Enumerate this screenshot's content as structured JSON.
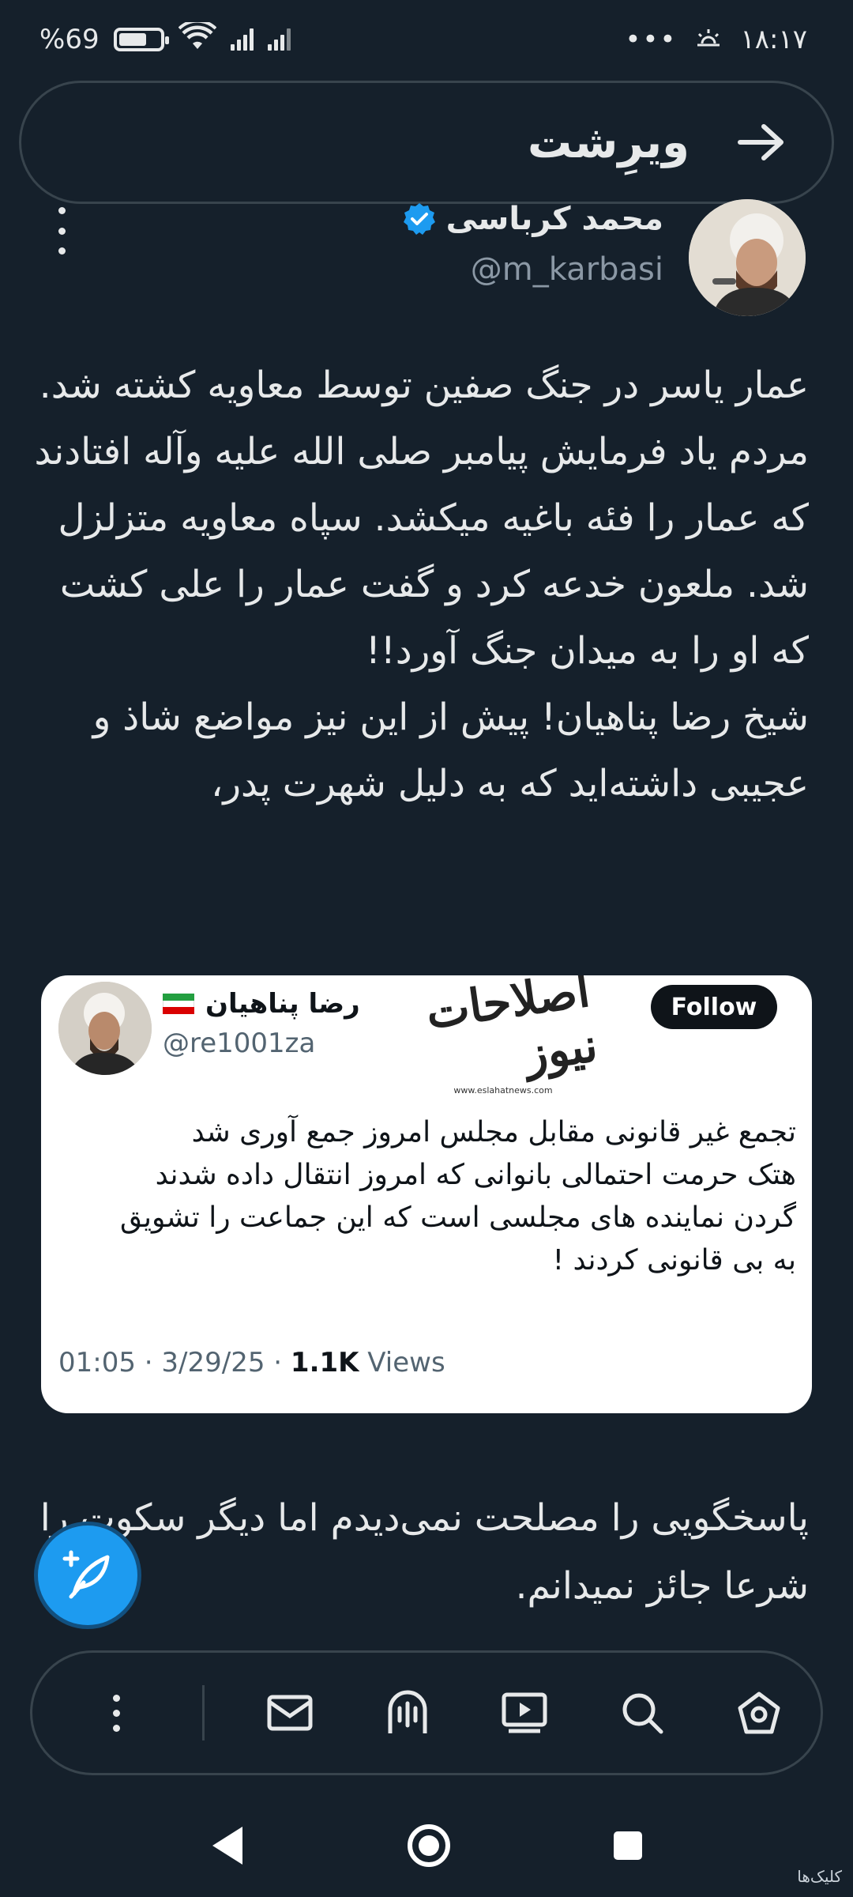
{
  "status_bar": {
    "battery": "69",
    "battery_percent_sign": "%",
    "time": "۱۸:۱۷",
    "overflow": "•••"
  },
  "header": {
    "title": "ویرِشت"
  },
  "author": {
    "name": "محمد کرباسی",
    "handle": "@m_karbasi",
    "verified": true
  },
  "tweet": {
    "text_part1": "عمار یاسر در جنگ صفین توسط معاویه کشته شد. مردم یاد فرمایش پیامبر صلی الله علیه وآله افتادند که عمار را فئه باغیه میکشد. سپاه معاویه متزلزل شد. ملعون خدعه کرد و گفت عمار را علی کشت که او را به میدان جنگ آورد!!",
    "text_part2": "شیخ رضا پناهیان! پیش از این نیز مواضع شاذ و عجیبی داشته‌اید که به دلیل شهرت پدر،",
    "text_part3": "پاسخگویی را مصلحت نمی‌دیدم اما دیگر سکوت را شرعا جائز نمیدانم."
  },
  "embed": {
    "name": "رضا پناهیان",
    "handle": "@re1001za",
    "follow_label": "Follow",
    "logo_text": "اصلاحات نیوز",
    "logo_url": "www.eslahatnews.com",
    "text_line1": "تجمع غیر قانونی مقابل مجلس امروز جمع آوری شد",
    "text_line2": "هتک حرمت احتمالی بانوانی که امروز انتقال داده شدند",
    "text_line3": "گردن نماینده های مجلسی است که این جماعت را تشویق",
    "text_line4": "به بی قانونی کردند !",
    "meta_time": "01:05 · 3/29/25 · ",
    "meta_views_count": "1.1K",
    "meta_views_label": " Views"
  },
  "bottom_nav": {
    "icons": [
      "more-icon",
      "mail-icon",
      "spaces-icon",
      "video-icon",
      "search-icon",
      "home-icon"
    ]
  },
  "watermark": "کلیک‌ها",
  "colors": {
    "background": "#15202b",
    "accent": "#1d9bf0",
    "border": "#38444d",
    "secondary_text": "#8b98a5"
  }
}
